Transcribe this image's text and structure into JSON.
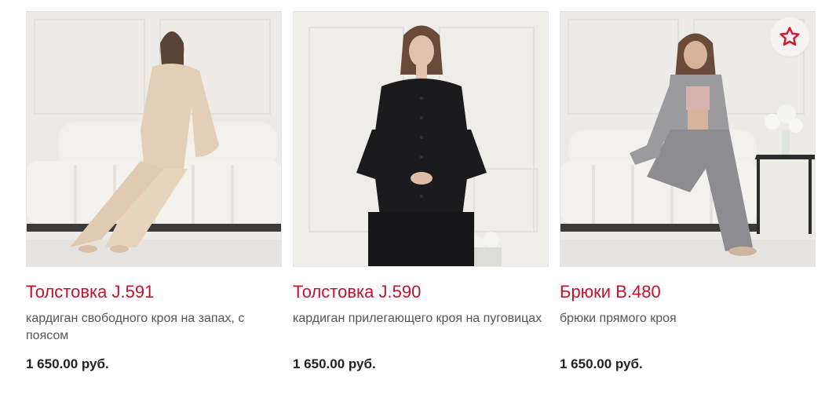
{
  "products": [
    {
      "title": "Толстовка J.591",
      "description": "кардиган свободного кроя на запах, с поясом",
      "price": "1 650.00 руб.",
      "image": "woman-beige-cardigan-photo"
    },
    {
      "title": "Толстовка J.590",
      "description": "кардиган прилегающего кроя на пуговицах",
      "price": "1 650.00 руб.",
      "image": "woman-black-cardigan-photo"
    },
    {
      "title": "Брюки B.480",
      "description": "брюки прямого кроя",
      "price": "1 650.00 руб.",
      "image": "woman-grey-pants-photo"
    }
  ],
  "favorite_icon": "star-outline-icon",
  "colors": {
    "title": "#c8102e",
    "favorite_star": "#d8142f",
    "price": "#222222"
  }
}
